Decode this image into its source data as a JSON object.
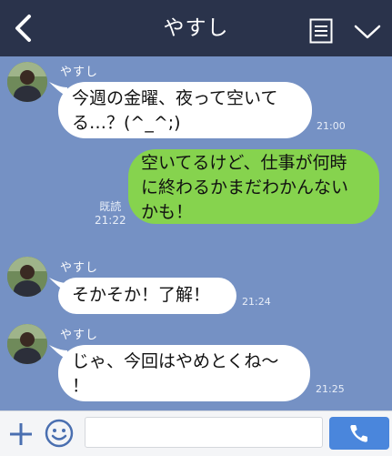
{
  "header": {
    "title": "やすし",
    "back_icon": "chevron-left-icon",
    "menu_icon": "memo-list-icon",
    "dropdown_icon": "chevron-down-icon"
  },
  "messages": [
    {
      "sender": "やすし",
      "lines": [
        "今週の金曜、夜って空いて",
        "る…？(^_^;)"
      ],
      "time": "21:00",
      "side": "left"
    },
    {
      "sender": "",
      "lines": [
        "空いてるけど、仕事が何時",
        "に終わるかまだわかんない",
        "かも！"
      ],
      "read_label": "既読",
      "time": "21:22",
      "side": "right"
    },
    {
      "sender": "やすし",
      "lines": [
        "そかそか！了解！"
      ],
      "time": "21:24",
      "side": "left"
    },
    {
      "sender": "やすし",
      "lines": [
        "じゃ、今回はやめとくね〜",
        "！"
      ],
      "time": "21:25",
      "side": "left"
    }
  ],
  "footer": {
    "plus_icon": "plus-icon",
    "emoji_icon": "smiley-icon",
    "input_value": "",
    "call_icon": "phone-icon"
  },
  "colors": {
    "background": "#7591c4",
    "header": "#2a334b",
    "my_bubble": "#86d34e",
    "their_bubble": "#ffffff",
    "call_button": "#4a86dc"
  }
}
